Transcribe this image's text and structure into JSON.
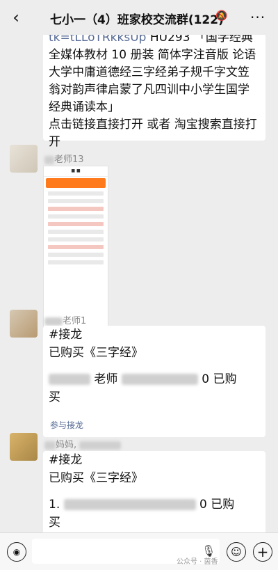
{
  "header": {
    "title": "七小一（4）班家校交流群(122)",
    "back_icon": "chevron-left-icon",
    "more_icon": "ellipsis-icon"
  },
  "messages": [
    {
      "id": "m1",
      "text_link": "tk=tLLoTRkksUp",
      "text_code": " HU293",
      "text_body": "「国学经典全媒体教材 10 册装 简体字注音版 论语大学中庸道德经三字经弟子规千字文笠翁对韵声律启蒙了凡四训中小学生国学经典诵读本」",
      "text_tail": "点击链接直接打开 或者 淘宝搜索直接打开"
    },
    {
      "id": "m2",
      "sender": "老师13",
      "type": "image"
    },
    {
      "id": "m3",
      "sender": "老师1",
      "line1": "#接龙",
      "line2": "已购买《三字经》",
      "line3a": "老师",
      "line3b": "0 已购",
      "line4": "买"
    },
    {
      "id": "m4",
      "sender": "妈妈,",
      "line1": "#接龙",
      "line2": "已购买《三字经》",
      "line3a": "1.",
      "line3b": "0 已购",
      "line4": "买"
    }
  ],
  "reply_link": "参与接龙",
  "watermark": "公众号 · 茵香"
}
